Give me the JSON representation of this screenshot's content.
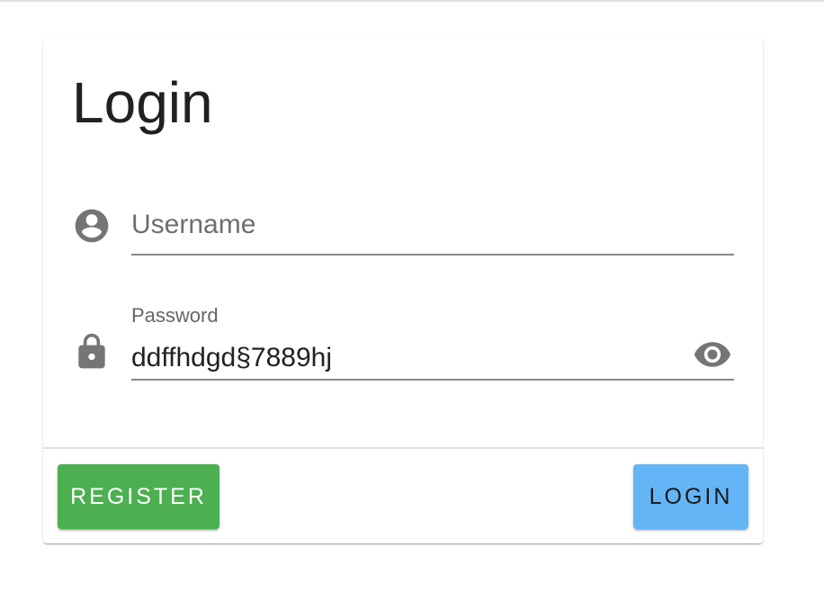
{
  "form": {
    "title": "Login",
    "username": {
      "placeholder": "Username",
      "value": "",
      "icon": "account-circle-icon"
    },
    "password": {
      "label": "Password",
      "value": "ddffhdgd§7889hj",
      "icon": "lock-icon",
      "toggle_icon": "eye-icon"
    },
    "buttons": {
      "register_label": "Register",
      "login_label": "Login"
    }
  },
  "colors": {
    "register": "#4caf50",
    "login": "#64b5f6",
    "icon": "#757575"
  }
}
